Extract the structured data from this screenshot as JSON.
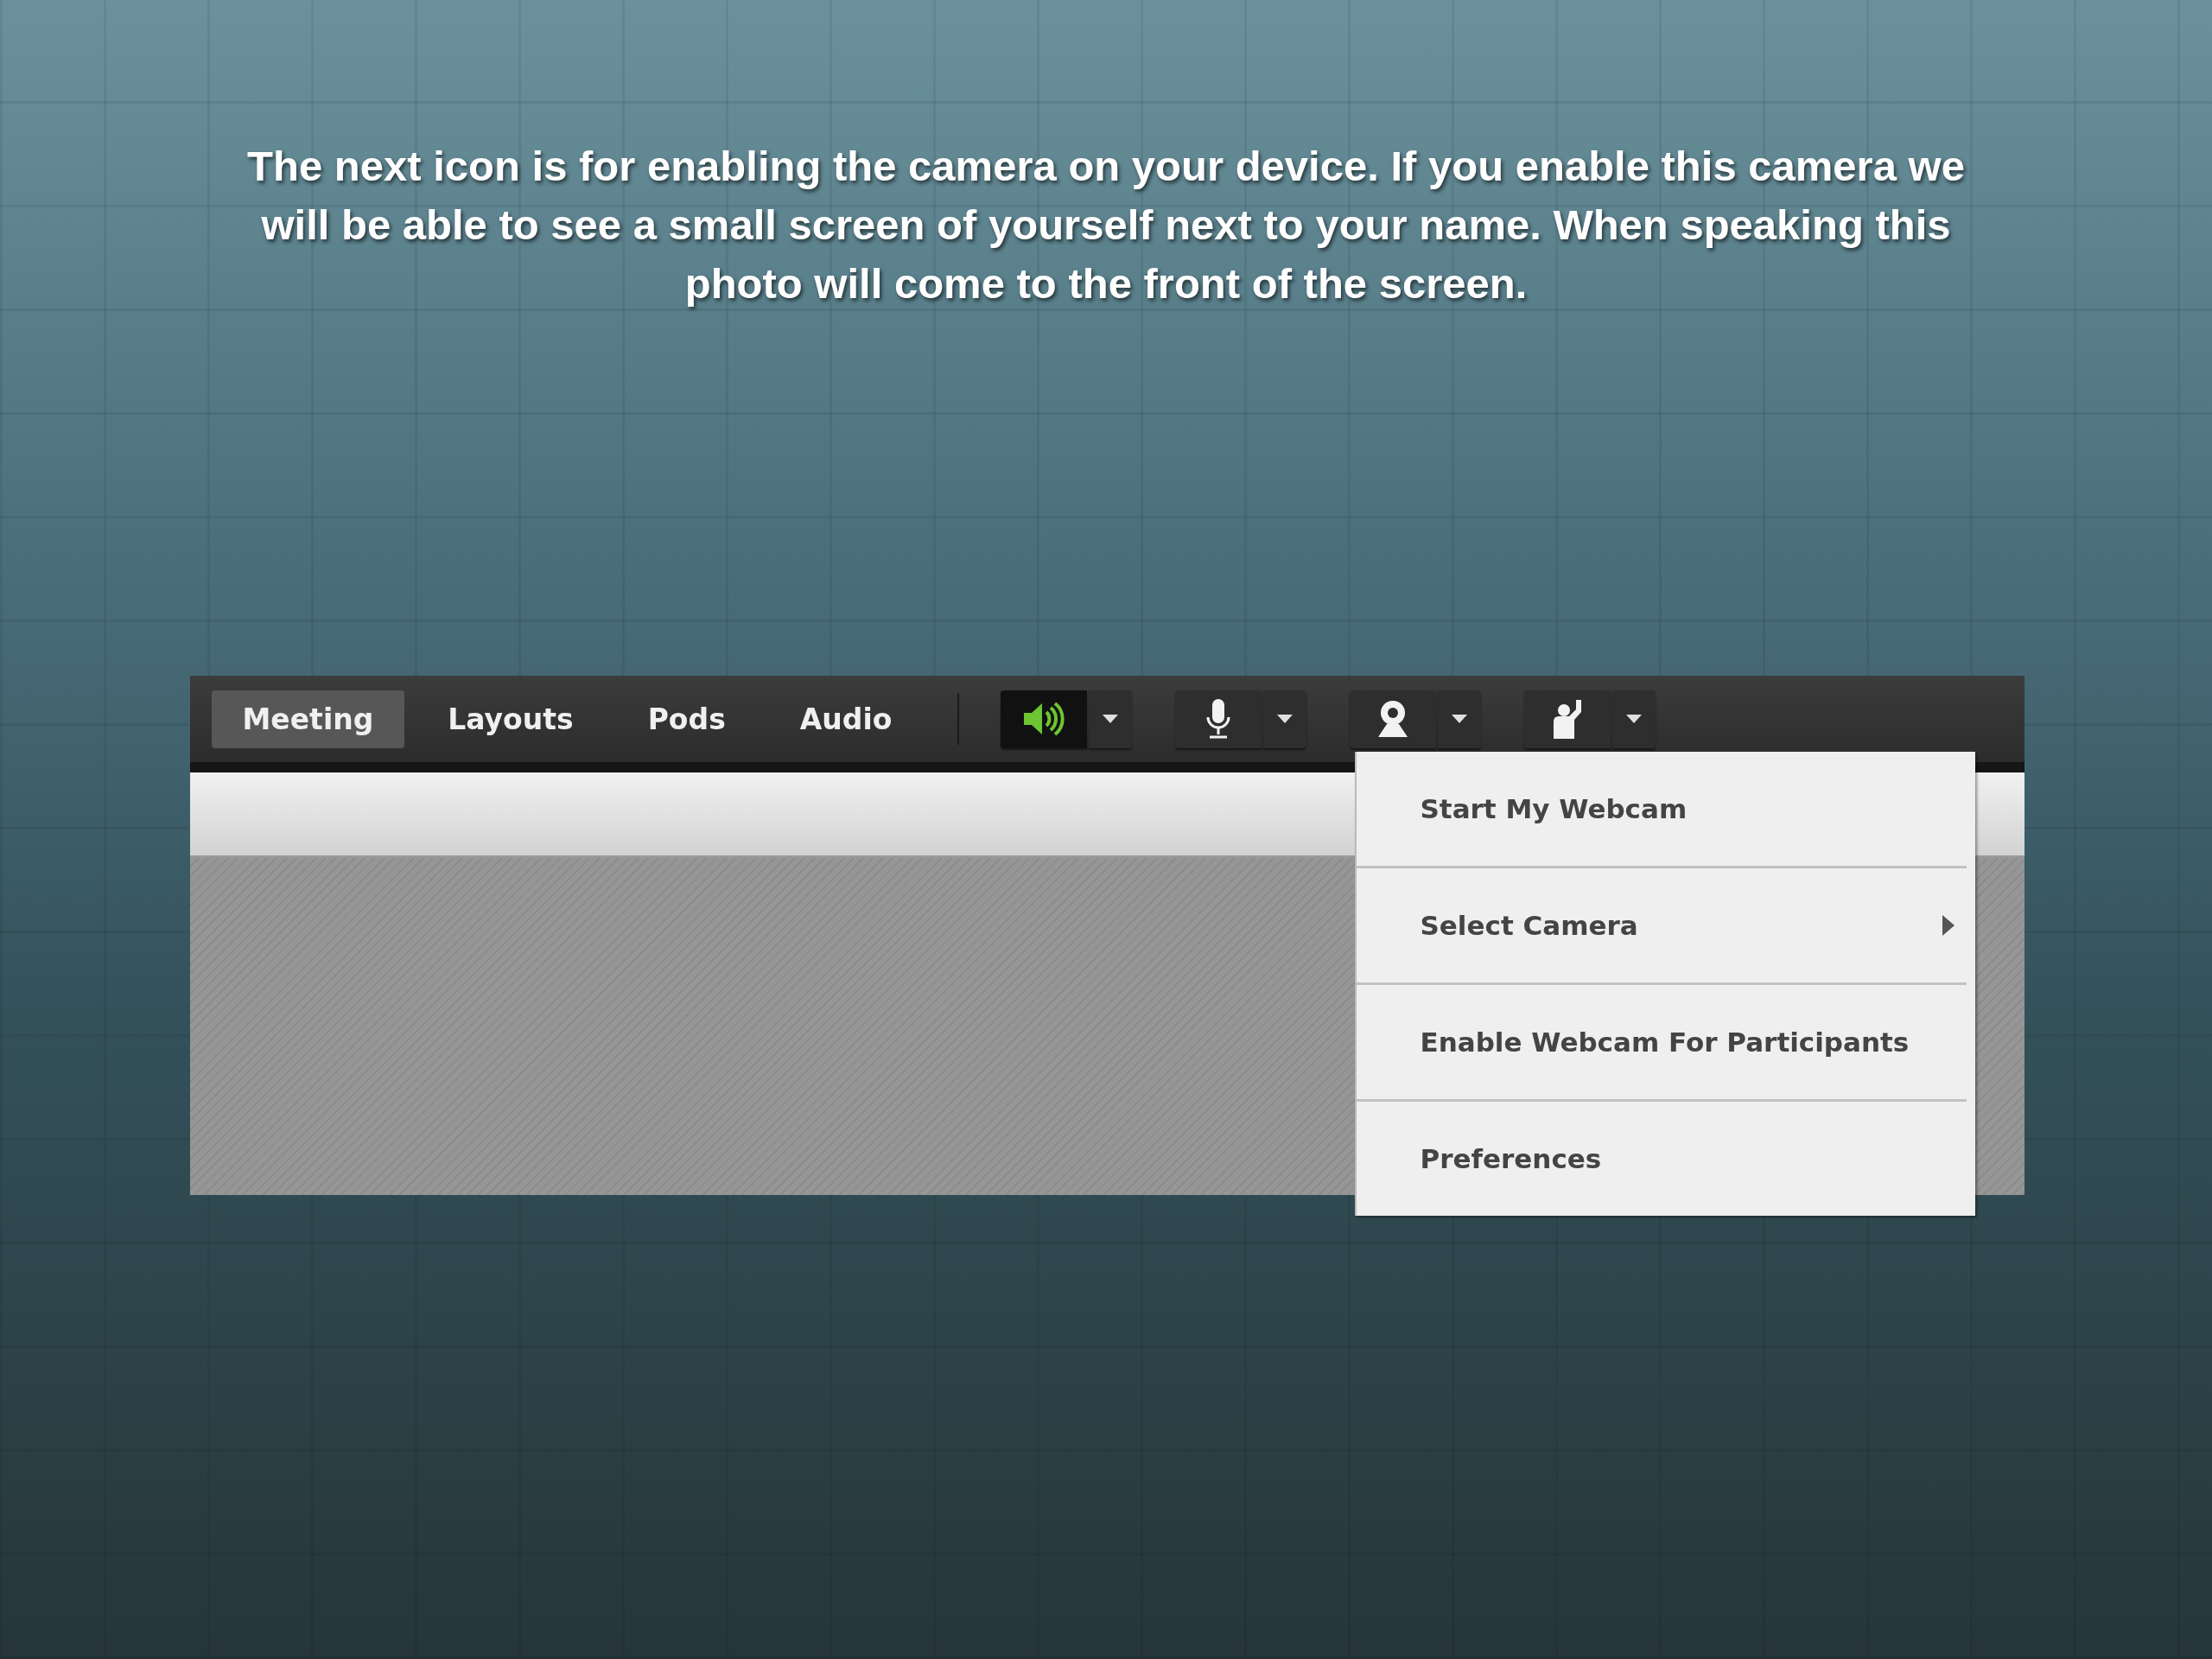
{
  "caption": "The next icon is for enabling the camera on your device. If you enable this camera we will be able to see a small screen of yourself next to your name. When speaking this photo will come to the front of the screen.",
  "toolbar": {
    "tabs": [
      {
        "label": "Meeting",
        "selected": true
      },
      {
        "label": "Layouts",
        "selected": false
      },
      {
        "label": "Pods",
        "selected": false
      },
      {
        "label": "Audio",
        "selected": false
      }
    ],
    "controls": [
      {
        "kind": "speaker",
        "active": true
      },
      {
        "kind": "microphone",
        "active": false
      },
      {
        "kind": "webcam",
        "active": false
      },
      {
        "kind": "raise-hand",
        "active": false
      }
    ]
  },
  "menu": {
    "items": [
      {
        "label": "Start My Webcam",
        "submenu": false
      },
      {
        "label": "Select Camera",
        "submenu": true
      },
      {
        "label": "Enable Webcam For Participants",
        "submenu": false
      },
      {
        "label": "Preferences",
        "submenu": false
      }
    ]
  }
}
